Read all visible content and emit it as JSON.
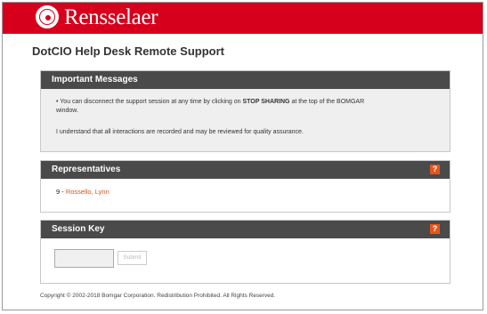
{
  "brand": {
    "name": "Rensselaer"
  },
  "page": {
    "title": "DotCIO Help Desk Remote Support"
  },
  "important_messages": {
    "title": "Important Messages",
    "bullet_prefix": "•  You can disconnect the support session at any time by clicking on ",
    "bullet_bold": "STOP SHARING",
    "bullet_suffix": " at the top of the BOMGAR",
    "bullet_line2": "window.",
    "notice": "I understand that all interactions are recorded and may be reviewed for quality assurance."
  },
  "representatives": {
    "title": "Representatives",
    "help": "?",
    "entries": [
      {
        "id_prefix": "9 - ",
        "name": "Rossello, Lynn"
      }
    ]
  },
  "session_key": {
    "title": "Session Key",
    "help": "?",
    "input_value": "",
    "submit_label": "Submit"
  },
  "footer": {
    "text": "Copyright © 2002-2018 Bomgar Corporation. Redistribution Prohibited. All Rights Reserved."
  },
  "colors": {
    "brand_red": "#d6001c",
    "header_gray": "#4a4a4a",
    "help_orange": "#e8541c",
    "link_orange": "#d6501c"
  }
}
